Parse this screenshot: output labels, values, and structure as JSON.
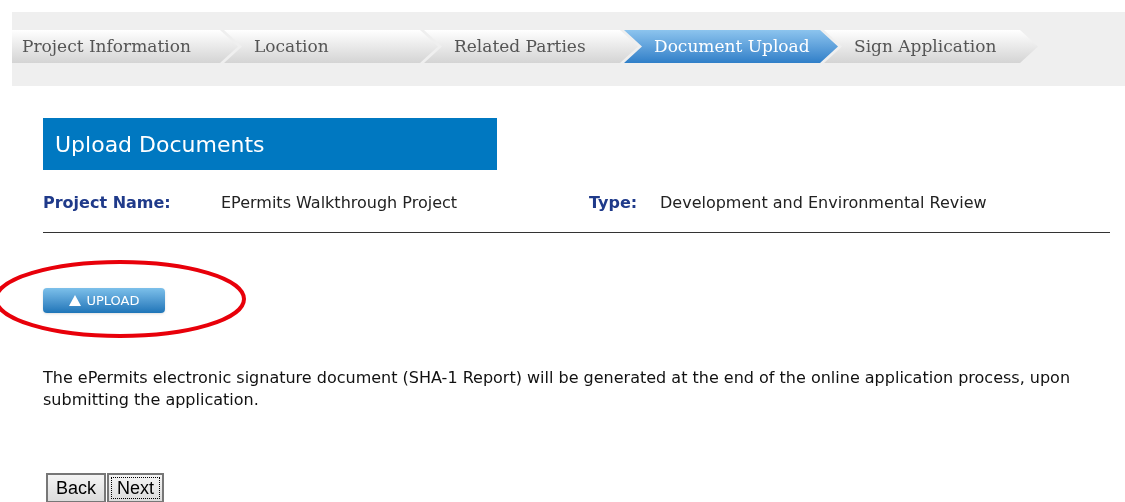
{
  "steps": [
    {
      "label": "Project Information",
      "selected": false
    },
    {
      "label": "Location",
      "selected": false
    },
    {
      "label": "Related Parties",
      "selected": false
    },
    {
      "label": "Document Upload",
      "selected": true
    },
    {
      "label": "Sign Application",
      "selected": false
    }
  ],
  "section_title": "Upload Documents",
  "project": {
    "name_label": "Project Name:",
    "name": "EPermits Walkthrough Project",
    "type_label": "Type:",
    "type": "Development and Environmental Review"
  },
  "upload_button": "UPLOAD",
  "notice": "The ePermits electronic signature document (SHA-1 Report) will be generated at the end of the online application process, upon submitting the application.",
  "buttons": [
    {
      "label": "Back",
      "focused": false
    },
    {
      "label": "Next",
      "focused": true
    }
  ]
}
